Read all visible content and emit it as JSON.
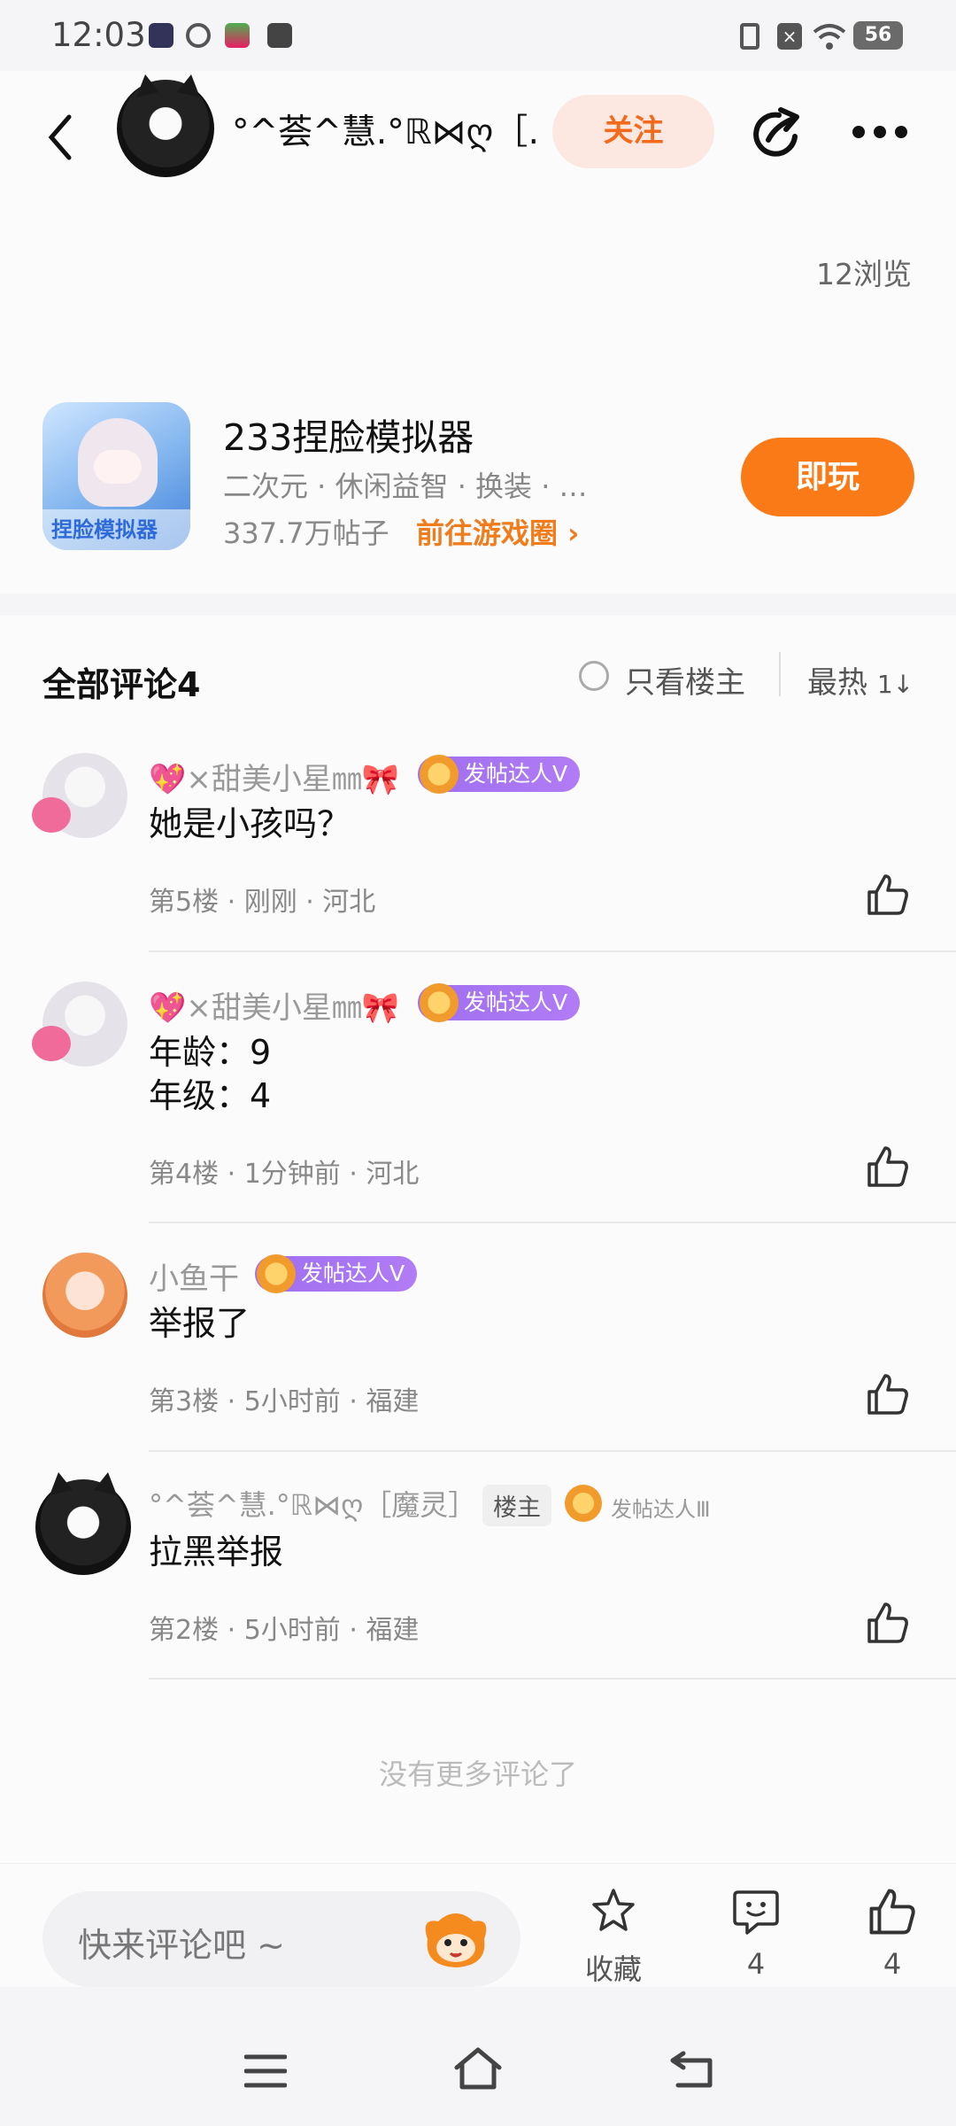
{
  "status_bar": {
    "time": "12:03",
    "battery": "56"
  },
  "header": {
    "username": "°^荟^慧.°ℝ⋈ღ［…",
    "follow_label": "关注",
    "views": "12浏览"
  },
  "game_card": {
    "name": "233捏脸模拟器",
    "tags": "二次元 · 休闲益智 · 换装 · …",
    "posts": "337.7万帖子",
    "link_label": "前往游戏圈",
    "play_label": "即玩",
    "icon_text": "捏脸模拟器"
  },
  "comments_section": {
    "title": "全部评论4",
    "only_host_label": "只看楼主",
    "sort_label": "最热",
    "sort_icon": "1↓",
    "comments": [
      {
        "name": "💖×甜美小星㎜🎀",
        "badge": "发帖达人Ⅴ",
        "text": "她是小孩吗？",
        "meta": "第5楼 · 刚刚 · 河北"
      },
      {
        "name": "💖×甜美小星㎜🎀",
        "badge": "发帖达人Ⅴ",
        "text": "年龄：9",
        "text2": "年级：4",
        "meta": "第4楼 · 1分钟前 · 河北"
      },
      {
        "name": "小鱼干",
        "badge": "发帖达人Ⅴ",
        "text": "举报了",
        "meta": "第3楼 · 5小时前 · 福建"
      },
      {
        "name": "°^荟^慧.°ℝ⋈ღ［魔灵］",
        "host_badge": "楼主",
        "badge": "发帖达人Ⅲ",
        "text": "拉黑举报",
        "meta": "第2楼 · 5小时前 · 福建"
      }
    ],
    "no_more": "没有更多评论了"
  },
  "bottom_bar": {
    "placeholder": "快来评论吧 ~",
    "favorite_label": "收藏",
    "comment_count": "4",
    "like_count": "4"
  },
  "colors": {
    "accent": "#f97a16",
    "badge_purple": "#a874f3",
    "follow_bg": "#fde8e1"
  }
}
